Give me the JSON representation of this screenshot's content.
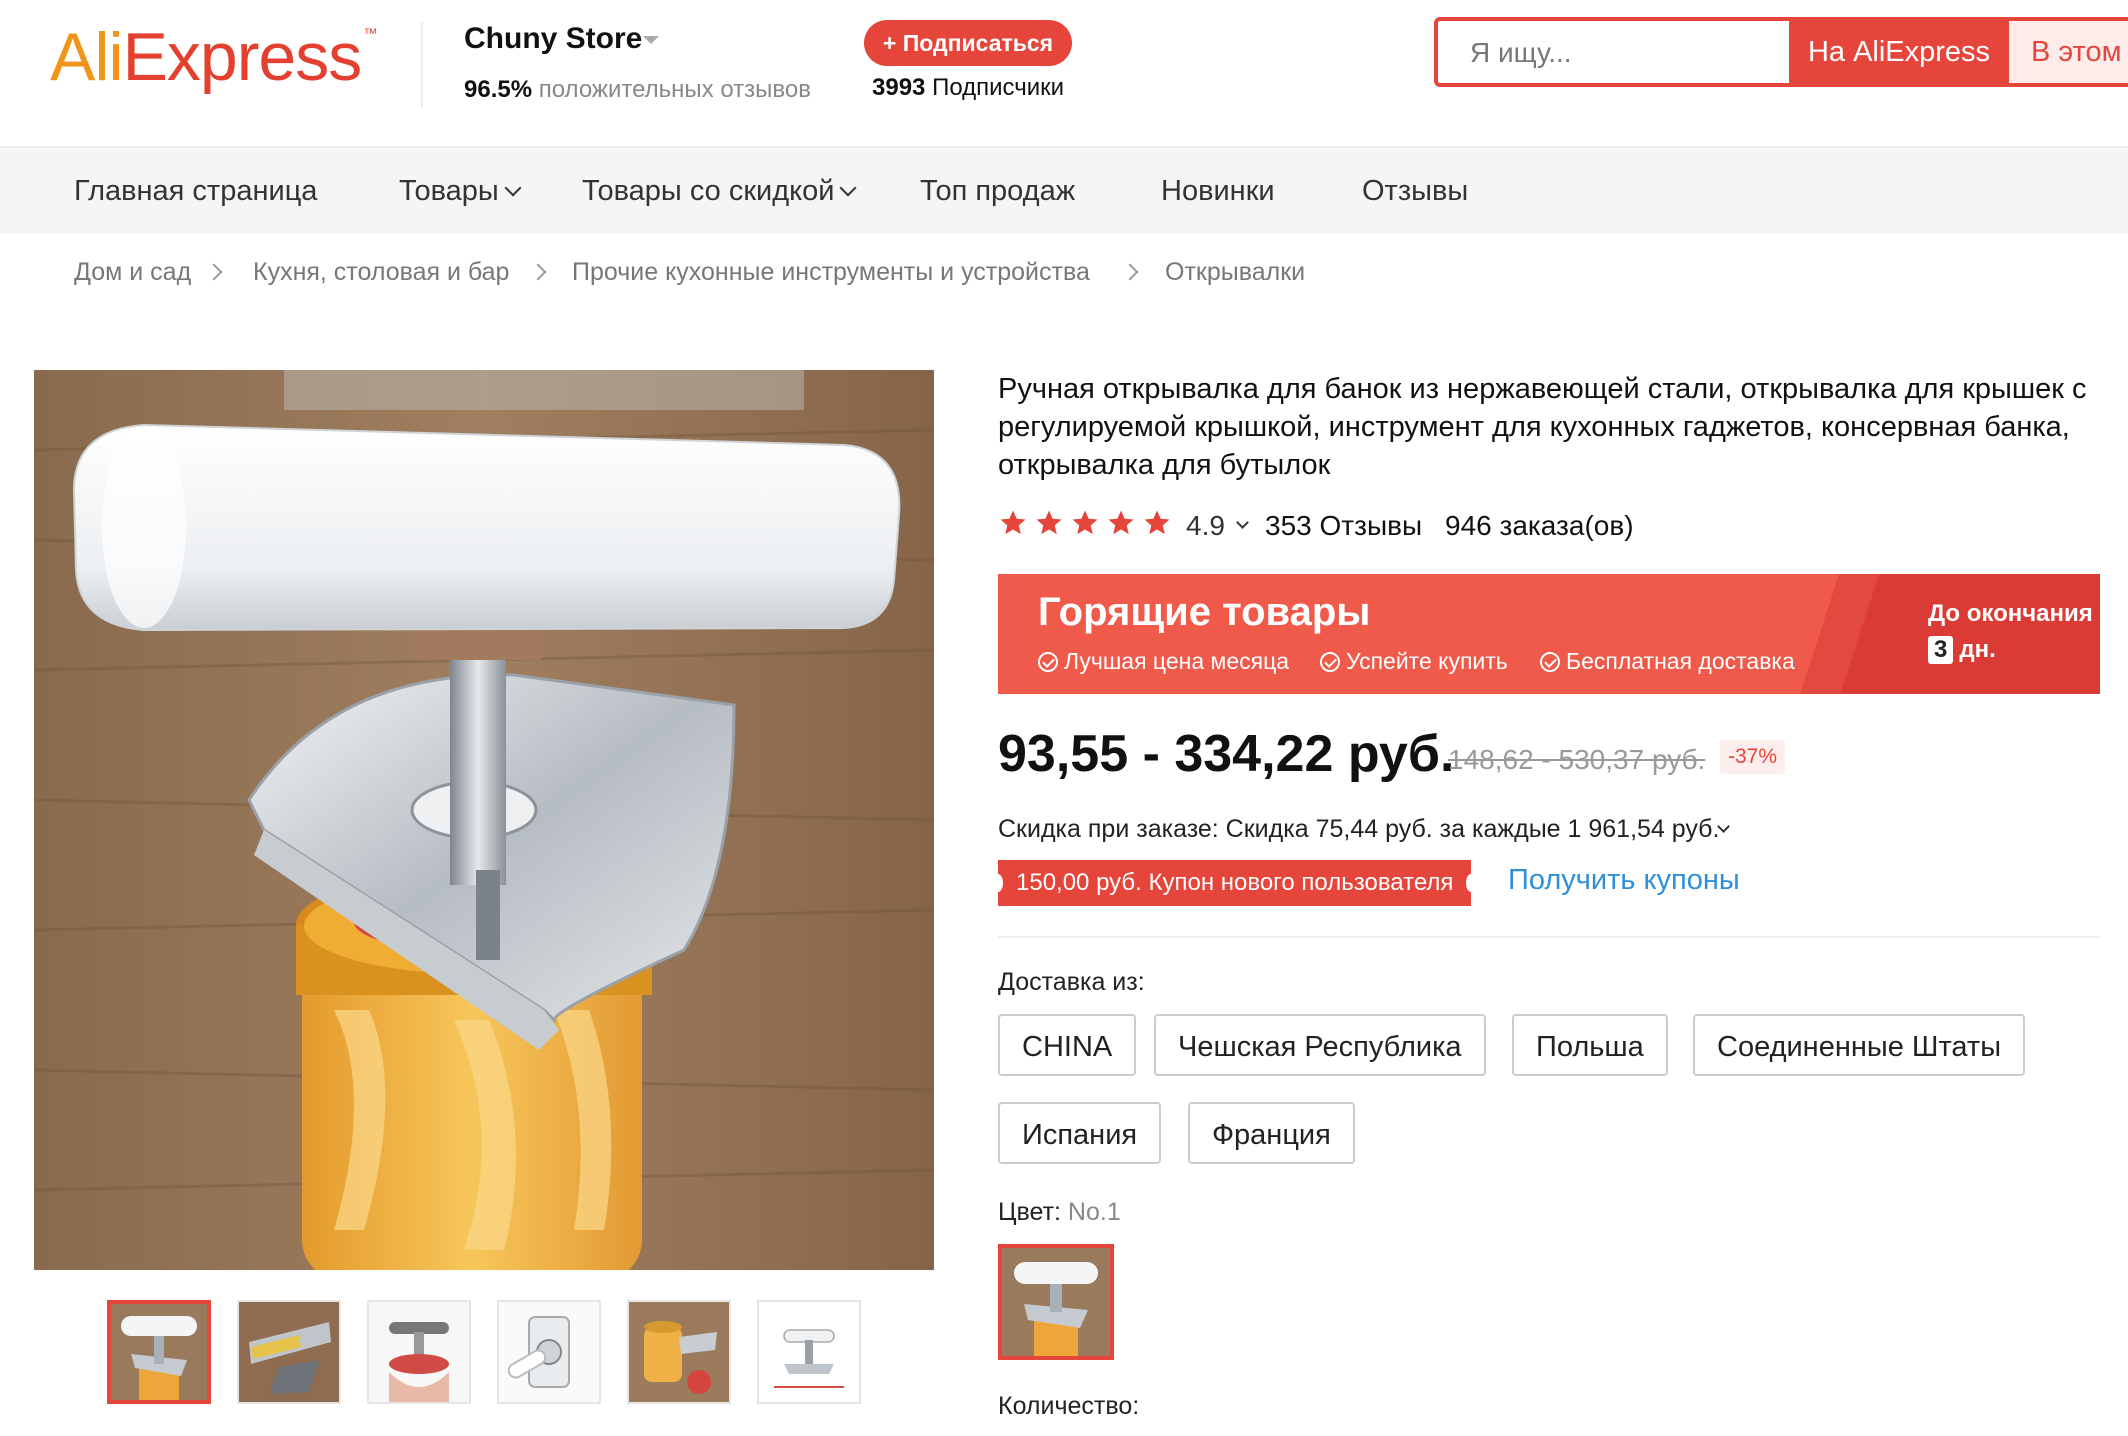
{
  "header": {
    "logo_part1": "Ali",
    "logo_part2": "Express",
    "logo_tm": "™",
    "store_name": "Chuny Store",
    "positive_percent": "96.5%",
    "positive_label": "положительных отзывов",
    "subscribe_label": "+ Подписаться",
    "subscribers_count": "3993",
    "subscribers_label": "Подписчики",
    "search_placeholder": "Я ищу...",
    "search_ali_label": "На AliExpress",
    "search_store_label": "В этом магазине"
  },
  "nav": {
    "items": [
      {
        "label": "Главная страница",
        "has_menu": false
      },
      {
        "label": "Товары",
        "has_menu": true
      },
      {
        "label": "Товары со скидкой",
        "has_menu": true
      },
      {
        "label": "Топ продаж",
        "has_menu": false
      },
      {
        "label": "Новинки",
        "has_menu": false
      },
      {
        "label": "Отзывы",
        "has_menu": false
      }
    ]
  },
  "breadcrumb": [
    "Дом и сад",
    "Кухня, столовая и бар",
    "Прочие кухонные инструменты и устройства",
    "Открывалки"
  ],
  "product": {
    "title": "Ручная открывалка для банок из нержавеющей стали, открывалка для крышек с регулируемой крышкой, инструмент для кухонных гаджетов, консервная банка, открывалка для бутылок",
    "rating": "4.9",
    "stars": 5,
    "reviews": "353 Отзывы",
    "orders": "946 заказа(ов)",
    "hot": {
      "title": "Горящие товары",
      "features": [
        "Лучшая цена месяца",
        "Успейте купить",
        "Бесплатная доставка"
      ],
      "ends_label": "До окончания",
      "days": "3",
      "days_unit": "дн."
    },
    "price": "93,55 - 334,22 руб.",
    "old_price": "148,62 - 530,37 руб.",
    "discount": "-37%",
    "order_discount": "Скидка при заказе: Скидка 75,44 руб. за каждые 1 961,54 руб.",
    "coupon": "150,00 руб. Купон нового пользователя",
    "get_coupons": "Получить купоны",
    "ship_from_label": "Доставка из:",
    "ship_from": [
      "CHINA",
      "Чешская Республика",
      "Польша",
      "Соединенные Штаты",
      "Испания",
      "Франция"
    ],
    "color_label": "Цвет:",
    "color_value": "No.1",
    "quantity_label": "Количество:"
  },
  "colors": {
    "accent": "#e5453a",
    "logo_orange": "#f19419",
    "link_blue": "#2f8fd9",
    "star": "#e5453a"
  },
  "gallery": {
    "thumb_count": 6,
    "active_index": 0
  }
}
